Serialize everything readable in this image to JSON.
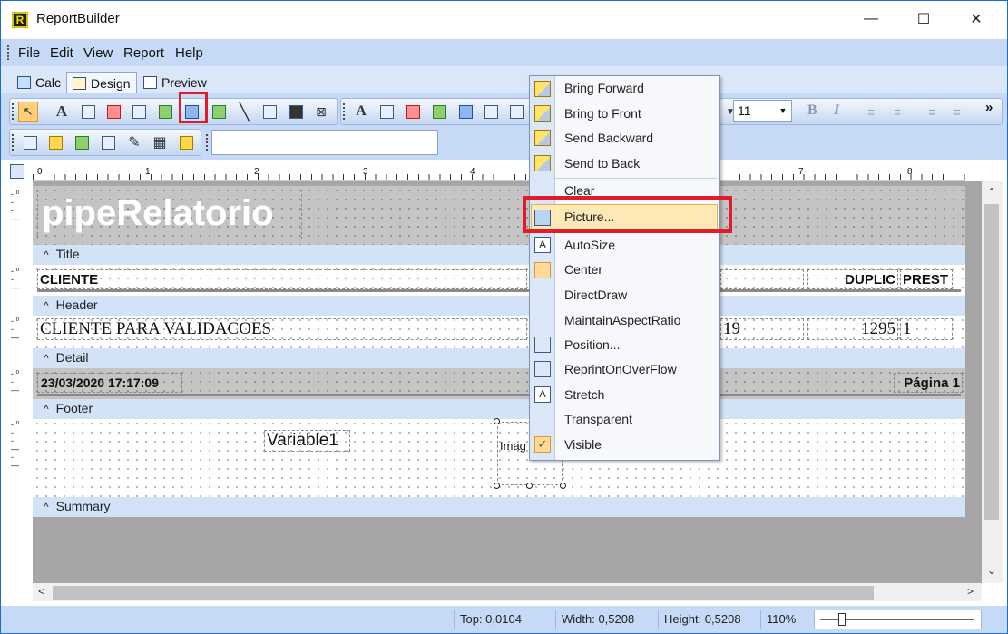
{
  "window": {
    "title": "ReportBuilder",
    "app_icon_letter": "R",
    "minimize": "—",
    "maximize": "☐",
    "close": "✕"
  },
  "menu": {
    "file": "File",
    "edit": "Edit",
    "view": "View",
    "report": "Report",
    "help": "Help"
  },
  "tabs": {
    "calc": "Calc",
    "design": "Design",
    "preview": "Preview"
  },
  "toolbar": {
    "font_size": "11",
    "bold": "B",
    "italic": "I",
    "more": "»"
  },
  "ruler": {
    "marks": [
      "0",
      "1",
      "2",
      "3",
      "4",
      "7",
      "8"
    ]
  },
  "bands": {
    "title": "Title",
    "header": "Header",
    "detail": "Detail",
    "footer": "Footer",
    "summary": "Summary"
  },
  "report": {
    "report_title": "pipeRelatorio",
    "header_cliente": "CLIENTE",
    "header_duplic": "DUPLIC",
    "header_prest": "PREST",
    "detail_cliente": "CLIENTE PARA VALIDACOES",
    "detail_num": "19",
    "detail_duplic": "1295",
    "detail_prest": "1",
    "footer_datetime": "23/03/2020 17:17:09",
    "footer_page": "Página 1",
    "summary_variable": "Variable1",
    "summary_image": "Imag"
  },
  "context_menu": {
    "items": [
      "Bring Forward",
      "Bring to Front",
      "Send Backward",
      "Send to Back",
      "Clear",
      "Picture...",
      "AutoSize",
      "Center",
      "DirectDraw",
      "MaintainAspectRatio",
      "Position...",
      "ReprintOnOverFlow",
      "Stretch",
      "Transparent",
      "Visible"
    ],
    "highlighted": "Picture..."
  },
  "status": {
    "top": "Top: 0,0104",
    "width": "Width: 0,5208",
    "height": "Height: 0,5208",
    "zoom": "110%"
  },
  "colors": {
    "highlight_box": "#e21b2a",
    "menu_bar": "#c6daf7",
    "band_label": "#d2e2f7"
  }
}
